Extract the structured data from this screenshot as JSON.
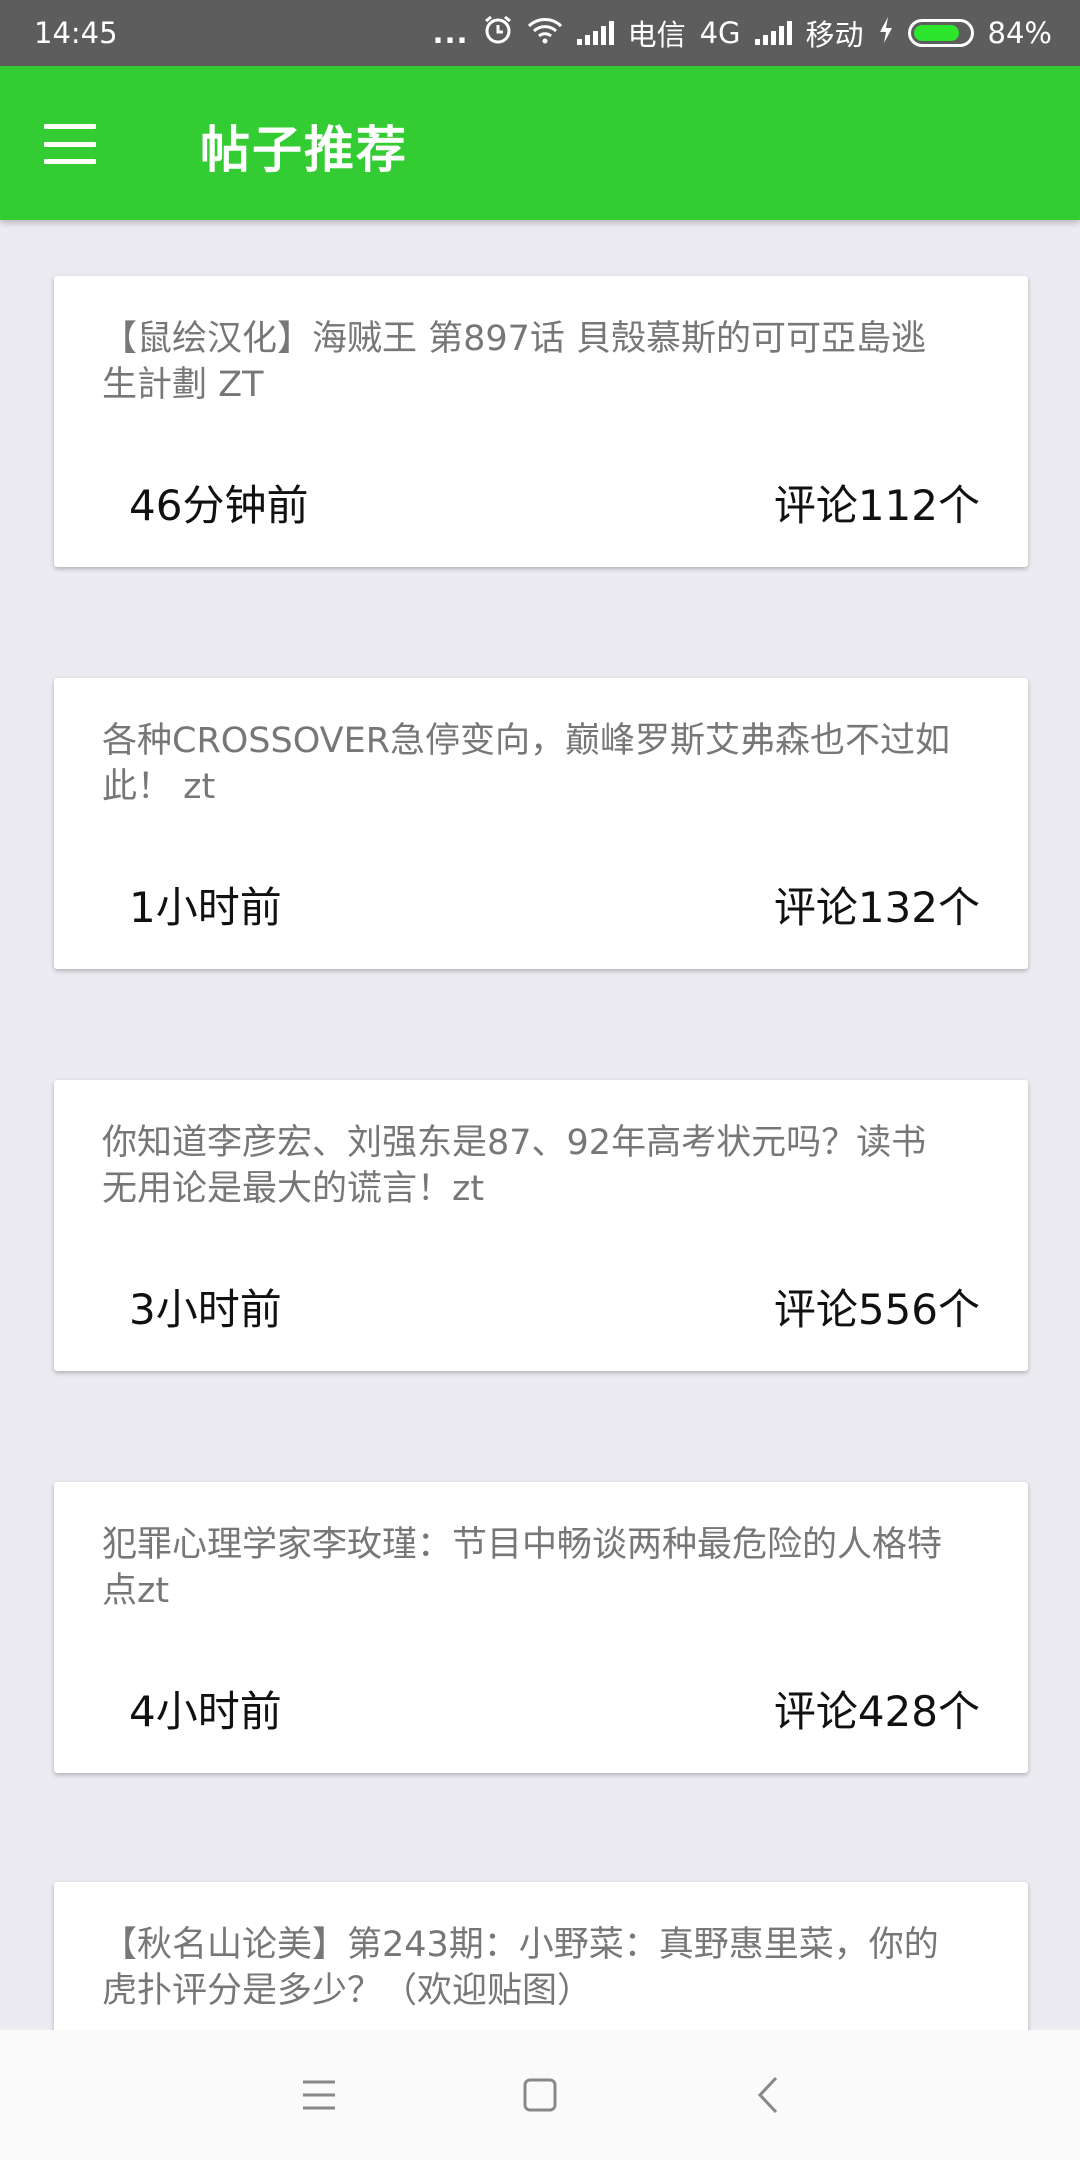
{
  "status_bar": {
    "time": "14:45",
    "dots": "...",
    "carrier1": "电信",
    "network": "4G",
    "carrier2": "移动",
    "battery_text": "84%",
    "battery_level": 0.84,
    "icons": [
      "alarm-icon",
      "wifi-icon",
      "signal-icon",
      "charging-icon",
      "battery-icon"
    ]
  },
  "app_bar": {
    "title": "帖子推荐",
    "menu_icon": "hamburger-menu-icon",
    "background": "#33cc33"
  },
  "posts": [
    {
      "title": "【鼠绘汉化】海贼王 第897话 貝殼慕斯的可可亞島逃生計劃 ZT",
      "time": "46分钟前",
      "comments": "评论112个"
    },
    {
      "title": "各种CROSSOVER急停变向，巅峰罗斯艾弗森也不过如此！ zt",
      "time": "1小时前",
      "comments": "评论132个"
    },
    {
      "title": "你知道李彦宏、刘强东是87、92年高考状元吗？读书无用论是最大的谎言！zt",
      "time": "3小时前",
      "comments": "评论556个"
    },
    {
      "title": "犯罪心理学家李玫瑾：节目中畅谈两种最危险的人格特点zt",
      "time": "4小时前",
      "comments": "评论428个"
    },
    {
      "title": "【秋名山论美】第243期：小野菜：真野惠里菜，你的虎扑评分是多少？（欢迎贴图）",
      "time": "",
      "comments": ""
    }
  ],
  "nav_bar": {
    "icons": [
      "recent-apps-icon",
      "home-icon",
      "back-icon"
    ]
  }
}
